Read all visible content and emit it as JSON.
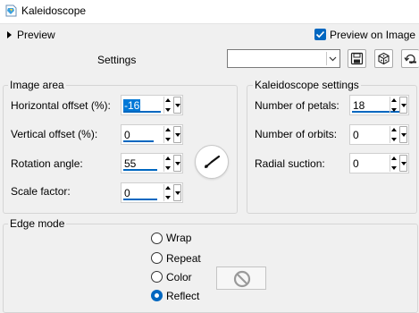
{
  "window": {
    "title": "Kaleidoscope"
  },
  "preview": {
    "label": "Preview",
    "preview_on_image_label": "Preview on Image",
    "preview_on_image_checked": true
  },
  "settings": {
    "label": "Settings",
    "value": ""
  },
  "image_area": {
    "title": "Image area",
    "horizontal_offset": {
      "label": "Horizontal offset (%):",
      "value": "-16"
    },
    "vertical_offset": {
      "label": "Vertical offset (%):",
      "value": "0"
    },
    "rotation_angle": {
      "label": "Rotation angle:",
      "value": "55"
    },
    "scale_factor": {
      "label": "Scale factor:",
      "value": "0"
    }
  },
  "kaleidoscope_settings": {
    "title": "Kaleidoscope settings",
    "number_of_petals": {
      "label": "Number of petals:",
      "value": "18"
    },
    "number_of_orbits": {
      "label": "Number of orbits:",
      "value": "0"
    },
    "radial_suction": {
      "label": "Radial suction:",
      "value": "0"
    }
  },
  "edge_mode": {
    "title": "Edge mode",
    "options": [
      "Wrap",
      "Repeat",
      "Color",
      "Reflect"
    ],
    "selected": "Reflect"
  },
  "colors": {
    "accent": "#0067c0",
    "selection": "#0078d7"
  },
  "icons": [
    "kaleidoscope-app-icon",
    "expand-arrow-icon",
    "checkmark-icon",
    "chevron-down-icon",
    "save-icon",
    "cube-icon",
    "reset-icon",
    "rotation-dial-icon",
    "no-color-icon"
  ]
}
